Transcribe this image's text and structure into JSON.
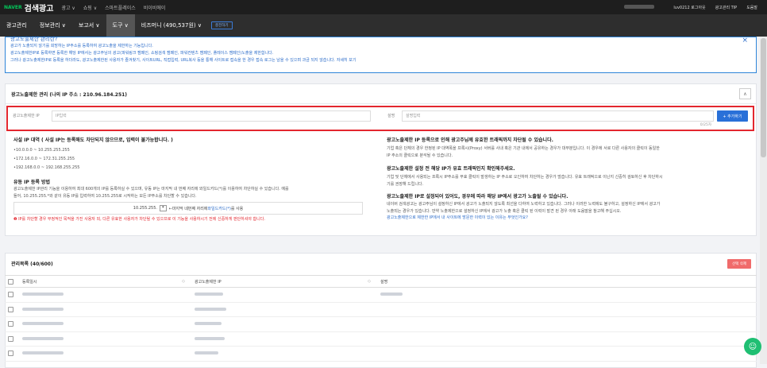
{
  "topbar": {
    "logo_brand": "NAVER",
    "logo_title": "검색광고",
    "nav": [
      "광고 ∨",
      "쇼핑 ∨",
      "스마트플레이스",
      "비이비에이"
    ],
    "user": "luv0212 로그아웃",
    "tip": "광고관리 TIP",
    "help": "도움말"
  },
  "navbar": {
    "items": [
      "광고관리",
      "정보관리 ∨",
      "보고서 ∨",
      "도구 ∨",
      "비즈머니 (490,537원) ∨"
    ],
    "active_index": 3,
    "schedule_label": "충전하기"
  },
  "info": {
    "title": "광고노출제한 관리란?",
    "line1": "광고가 노출되지 않기를 희망하는 IP주소를 등록하여 광고노출을 제한하는 기능입니다.",
    "line2": "광고노출제한IP로 등록하면 등록한 해당 IP에서는 광고주님의 광고(파워링크 캠페인, 쇼핑검색 캠페인, 파워컨텐츠 캠페인, 플레이스 캠페인)노출을 제한합니다.",
    "line3": "그러나 광고노출제한IP로 등록을 하더라도, 광고노출제한된 사용자가 즐겨찾기, 사이트URL, 직접입력, URL복사 등을 통해 사이트로 접속을 한 경우 접속 로그는 남을 수 있으며 과금 되지 않습니다.",
    "link": "자세히 보기",
    "close": "×"
  },
  "card1": {
    "title": "광고노출제한 관리 (나의 IP 주소 : 210.96.184.251)",
    "collapse": "∧",
    "ip_label": "광고노출제한 IP",
    "ip_placeholder": "IP입력",
    "desc_label": "설명",
    "desc_placeholder": "설명입력",
    "count": "0/25자",
    "add_button": "+ 추가하기",
    "private_title": "사설 IP 대역 ( 사설 IP는 등록해도 차단되지 않으므로, 입력이 불가능합니다. )",
    "private_ranges": [
      "•10.0.0.0 ~ 10.255.255.255",
      "•172.16.0.0 ~ 172.31.255.255",
      "•192.168.0.0 ~ 192.168.255.255"
    ],
    "dyn_title": "유동 IP 등록 방법",
    "dyn_text1": "광고노출제한 IP관리 기능을 이용하여 최대 600개의 IP를 등록하실 수 있으며, 유동 IP는 마지막 내 번째 자리에 와일드카드(*)를 이용하여 차단하실 수 있습니다. 예를",
    "dyn_text2": "들어, 10.255.255.*와 같이 유동 IP를 입력하여 10.255.255로 시작하는 모든 IP주소를 차단할 수 있습니다.",
    "example_ip": "10.255.255.",
    "example_star": "*",
    "example_text": "←마지막 네번째 자리에",
    "example_link": "와일드카드(*)",
    "example_tail": "를 사용",
    "warning": "❶ IP를 차단할 경우 부정적인 목적을 가진 사용자 외, 다른 유효한 사용자가 차단될 수 있으므로 이 기능을 사용하시기 전에 신중하게 판단하셔야 합니다.",
    "r1_title": "광고노출제한 IP 등록으로 인해 광고주님께 유효한 트래픽까지 차단될 수 있습니다.",
    "r1_text1": "기업 혹은 단체의 경우 한정된 IP 대역폭을 프록시(Proxy) 서버를 사내 혹은 기관 내에서 공유하는 경우가 대부분입니다. 이 경우에 서로 다른 사용자의 클릭이 동일한",
    "r1_text2": "IP 주소의 클릭으로 분석될 수 있습니다.",
    "r2_title": "광고노출제한 설정 전 해당 IP가 유효 트래픽인지 확인해주세요.",
    "r2_text1": "기업 및 단체에서 사용되는 프록시 IP주소를 무효 클릭이 발생하는 IP 주소로 오인하여 차단하는 경우가 많습니다. 유효 트래픽으로 이닌지 신중히 검토하신 후 차단하시",
    "r2_text2": "기를 권장해 드립니다.",
    "r3_title": "광고노출제한 IP로 설정되어 있어도, 경우에 따라 해당 IP에서 광고가 노출될 수 있습니다.",
    "r3_text1": "네이버 검색광고는 광고주님이 설정하신 IP에서 광고가 노출되지 않도록 최선을 다하여 노력하고 있습니다. 그러나 이러한 노력에도 불구하고, 설정하신 IP에서 광고가",
    "r3_text2": "노출되는 경우가 있습니다. 만약 노출제한으로 설정하신 IP에서 광고가 노출 혹은 클릭 된 이력이 발견 된 경우 아래 도움말을 참고해 주십시오.",
    "r3_link": "광고노출제한으로 제한한 IP에서 내 사이트에 방문한 이력이 있는 이유는 무엇인가요?"
  },
  "card2": {
    "title": "관리목록 (40/600)",
    "delete_button": "선택 삭제",
    "columns": [
      "등록일시",
      "광고노출제한 IP",
      "설명"
    ],
    "sort_icon": "◇"
  }
}
